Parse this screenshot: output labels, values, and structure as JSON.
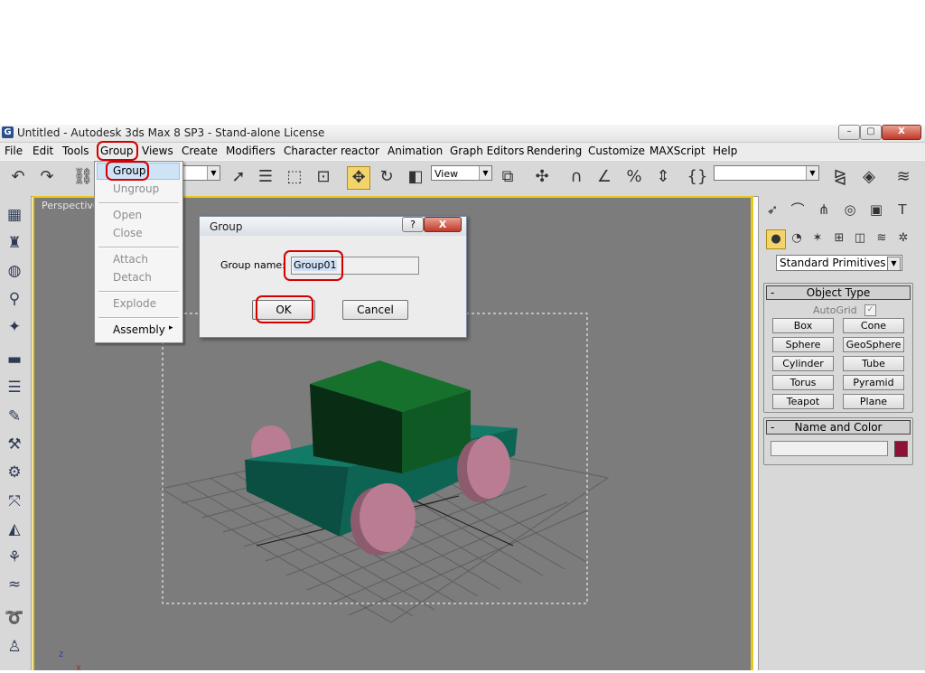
{
  "window": {
    "title": "Untitled - Autodesk 3ds Max 8 SP3  - Stand-alone License",
    "app_icon_glyph": "G",
    "minimize_glyph": "–",
    "maximize_glyph": "▢",
    "close_glyph": "X"
  },
  "menubar": {
    "items": [
      "File",
      "Edit",
      "Tools",
      "Group",
      "Views",
      "Create",
      "Modifiers",
      "Character",
      "reactor",
      "Animation",
      "Graph Editors",
      "Rendering",
      "Customize",
      "MAXScript",
      "Help"
    ]
  },
  "toolbar": {
    "view_combo": "View",
    "named_selection_combo": "",
    "icons": [
      "undo-icon",
      "redo-icon",
      "select-link-icon",
      "select-object-icon",
      "select-by-name-icon",
      "rect-select-region-icon",
      "window-crossing-icon",
      "select-move-icon",
      "select-rotate-icon",
      "select-scale-icon",
      "pivot-icon",
      "manipulate-icon",
      "snaps-toggle-icon",
      "angle-snap-icon",
      "percent-snap-icon",
      "spinner-snap-icon",
      "edit-named-selection-icon",
      "mirror-icon",
      "align-icon",
      "layer-manager-icon"
    ]
  },
  "group_menu": {
    "items": [
      {
        "label": "Group",
        "enabled": true
      },
      {
        "label": "Ungroup",
        "enabled": false
      },
      {
        "label": "Open",
        "enabled": false
      },
      {
        "label": "Close",
        "enabled": false
      },
      {
        "label": "Attach",
        "enabled": false
      },
      {
        "label": "Detach",
        "enabled": false
      },
      {
        "label": "Explode",
        "enabled": false
      },
      {
        "label": "Assembly",
        "enabled": true
      }
    ],
    "submenu_arrow": "▸"
  },
  "viewport": {
    "label": "Perspective",
    "axis_z": "z",
    "axis_x": "x"
  },
  "dialog": {
    "title": "Group",
    "help_glyph": "?",
    "close_glyph": "X",
    "name_label": "Group name:",
    "name_value": "Group01",
    "ok_label": "OK",
    "cancel_label": "Cancel"
  },
  "command_panel": {
    "category_dropdown": "Standard Primitives",
    "object_type_title": "Object Type",
    "autogrid_label": "AutoGrid",
    "autogrid_checked": true,
    "object_buttons": [
      "Box",
      "Cone",
      "Sphere",
      "GeoSphere",
      "Cylinder",
      "Tube",
      "Torus",
      "Pyramid",
      "Teapot",
      "Plane"
    ],
    "name_color_title": "Name and Color",
    "name_value": "",
    "object_color": "#8e1237"
  },
  "colors": {
    "viewport_bg": "#7c7c7c",
    "active_viewport_border": "#e8c81a",
    "car_body": "#0e5a4c",
    "car_cabin": "#0f5a24",
    "wheels": "#b97c93",
    "annotation": "#d40000"
  }
}
